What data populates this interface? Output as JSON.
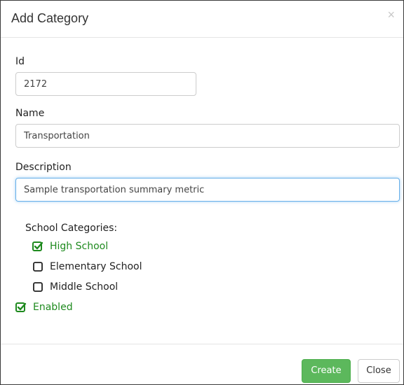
{
  "modal": {
    "title": "Add Category",
    "close_glyph": "×"
  },
  "fields": {
    "id": {
      "label": "Id",
      "value": "2172"
    },
    "name": {
      "label": "Name",
      "value": "Transportation"
    },
    "description": {
      "label": "Description",
      "value": "Sample transportation summary metric"
    }
  },
  "school_categories": {
    "label": "School Categories:",
    "items": [
      {
        "label": "High School",
        "checked": true
      },
      {
        "label": "Elementary School",
        "checked": false
      },
      {
        "label": "Middle School",
        "checked": false
      }
    ]
  },
  "enabled": {
    "label": "Enabled",
    "checked": true
  },
  "footer": {
    "create_label": "Create",
    "close_label": "Close"
  },
  "icons": {
    "checked": "checked-square-icon",
    "unchecked": "empty-square-icon",
    "close": "close-icon"
  },
  "colors": {
    "checked_text": "#1e8a1e",
    "create_button": "#5cb85c",
    "focus_border": "#66afe9"
  }
}
